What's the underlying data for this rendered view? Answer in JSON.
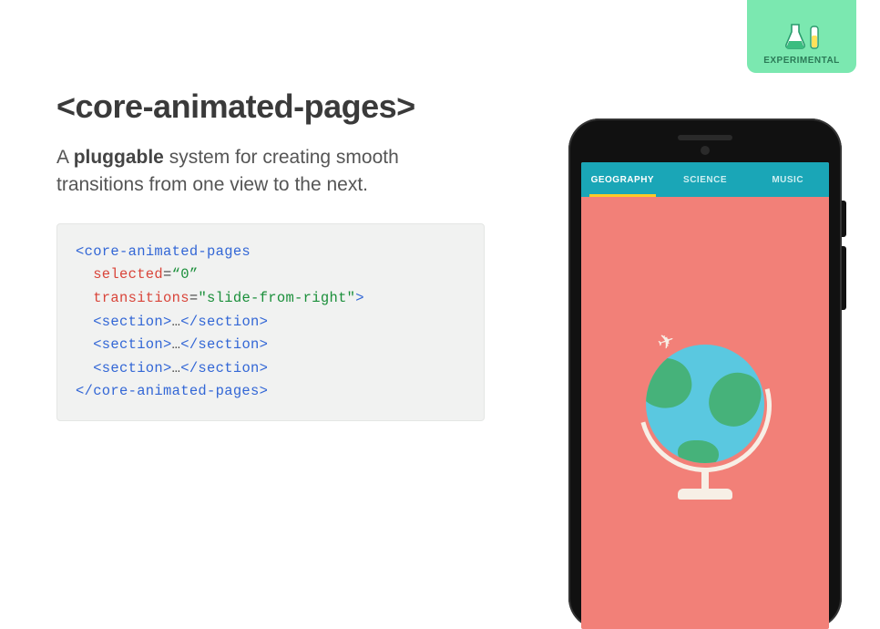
{
  "badge": {
    "label": "EXPERIMENTAL"
  },
  "header": {
    "title": "<core-animated-pages>"
  },
  "subtitle": {
    "pre": "A ",
    "bold": "pluggable",
    "post": " system for creating smooth transitions from one view to the next."
  },
  "code": {
    "open_tag": "core-animated-pages",
    "attr1_name": "selected",
    "attr1_eq": "=",
    "attr1_q1": "“",
    "attr1_val": "0",
    "attr1_q2": "”",
    "attr2_name": "transitions",
    "attr2_eq": "=",
    "attr2_q1": "\"",
    "attr2_val": "slide-from-right",
    "attr2_q2": "\"",
    "open_end": ">",
    "section_open": "<section>",
    "ellipsis": "…",
    "section_close": "</section>",
    "close_tag": "</core-animated-pages>"
  },
  "phone": {
    "tabs": [
      "GEOGRAPHY",
      "SCIENCE",
      "MUSIC"
    ],
    "active_tab_index": 0
  }
}
